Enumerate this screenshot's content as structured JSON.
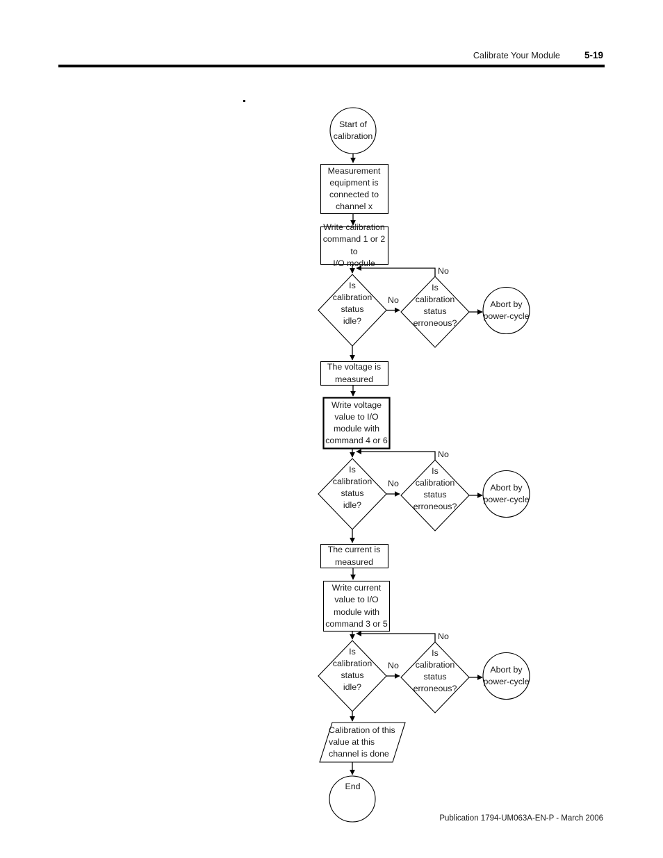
{
  "header": {
    "title": "Calibrate Your Module",
    "page_number": "5-19"
  },
  "footer": {
    "publication": "Publication 1794-UM063A-EN-P - March 2006"
  },
  "chart_data": {
    "type": "diagram",
    "diagram_kind": "flowchart",
    "title": "",
    "nodes": [
      {
        "id": "start",
        "shape": "circle",
        "text": "Start of\ncalibration"
      },
      {
        "id": "measure_eq",
        "shape": "rect",
        "text": "Measurement\nequipment is\nconnected to\nchannel x"
      },
      {
        "id": "write_cal",
        "shape": "rect",
        "text": "Write calibration\ncommand 1 or 2 to\nI/O module"
      },
      {
        "id": "idle1",
        "shape": "diamond",
        "text": "Is\ncalibration\nstatus\nidle?"
      },
      {
        "id": "err1",
        "shape": "diamond",
        "text": "Is\ncalibration\nstatus\nerroneous?"
      },
      {
        "id": "abort1",
        "shape": "circle",
        "text": "Abort by\npower-cycle"
      },
      {
        "id": "volt_meas",
        "shape": "rect",
        "text": "The voltage is\nmeasured"
      },
      {
        "id": "write_volt",
        "shape": "rect-bold",
        "text": "Write voltage\nvalue to I/O\nmodule with\ncommand 4 or 6"
      },
      {
        "id": "idle2",
        "shape": "diamond",
        "text": "Is\ncalibration\nstatus\nidle?"
      },
      {
        "id": "err2",
        "shape": "diamond",
        "text": "Is\ncalibration\nstatus\nerroneous?"
      },
      {
        "id": "abort2",
        "shape": "circle",
        "text": "Abort by\npower-cycle"
      },
      {
        "id": "curr_meas",
        "shape": "rect",
        "text": "The current is\nmeasured"
      },
      {
        "id": "write_curr",
        "shape": "rect",
        "text": "Write current\nvalue to I/O\nmodule with\ncommand 3 or 5"
      },
      {
        "id": "idle3",
        "shape": "diamond",
        "text": "Is\ncalibration\nstatus\nidle?"
      },
      {
        "id": "err3",
        "shape": "diamond",
        "text": "Is\ncalibration\nstatus\nerroneous?"
      },
      {
        "id": "abort3",
        "shape": "circle",
        "text": "Abort by\npower-cycle"
      },
      {
        "id": "done",
        "shape": "parallelogram",
        "text": "Calibration of this\nvalue at this\nchannel is done"
      },
      {
        "id": "end",
        "shape": "circle",
        "text": "End"
      }
    ],
    "edge_labels": [
      {
        "id": "no-idle1",
        "text": "No"
      },
      {
        "id": "no-err1",
        "text": "No"
      },
      {
        "id": "no-idle2",
        "text": "No"
      },
      {
        "id": "no-err2",
        "text": "No"
      },
      {
        "id": "no-idle3",
        "text": "No"
      },
      {
        "id": "no-err3",
        "text": "No"
      }
    ],
    "edges": [
      {
        "from": "start",
        "to": "measure_eq",
        "label": ""
      },
      {
        "from": "measure_eq",
        "to": "write_cal",
        "label": ""
      },
      {
        "from": "write_cal",
        "to": "idle1",
        "label": ""
      },
      {
        "from": "idle1",
        "to": "err1",
        "label": "No"
      },
      {
        "from": "err1",
        "to": "abort1",
        "label": ""
      },
      {
        "from": "err1",
        "to": "idle1",
        "label": "No"
      },
      {
        "from": "idle1",
        "to": "volt_meas",
        "label": ""
      },
      {
        "from": "volt_meas",
        "to": "write_volt",
        "label": ""
      },
      {
        "from": "write_volt",
        "to": "idle2",
        "label": ""
      },
      {
        "from": "idle2",
        "to": "err2",
        "label": "No"
      },
      {
        "from": "err2",
        "to": "abort2",
        "label": ""
      },
      {
        "from": "err2",
        "to": "idle2",
        "label": "No"
      },
      {
        "from": "idle2",
        "to": "curr_meas",
        "label": ""
      },
      {
        "from": "curr_meas",
        "to": "write_curr",
        "label": ""
      },
      {
        "from": "write_curr",
        "to": "idle3",
        "label": ""
      },
      {
        "from": "idle3",
        "to": "err3",
        "label": "No"
      },
      {
        "from": "err3",
        "to": "abort3",
        "label": ""
      },
      {
        "from": "err3",
        "to": "idle3",
        "label": "No"
      },
      {
        "from": "idle3",
        "to": "done",
        "label": ""
      },
      {
        "from": "done",
        "to": "end",
        "label": ""
      }
    ]
  }
}
